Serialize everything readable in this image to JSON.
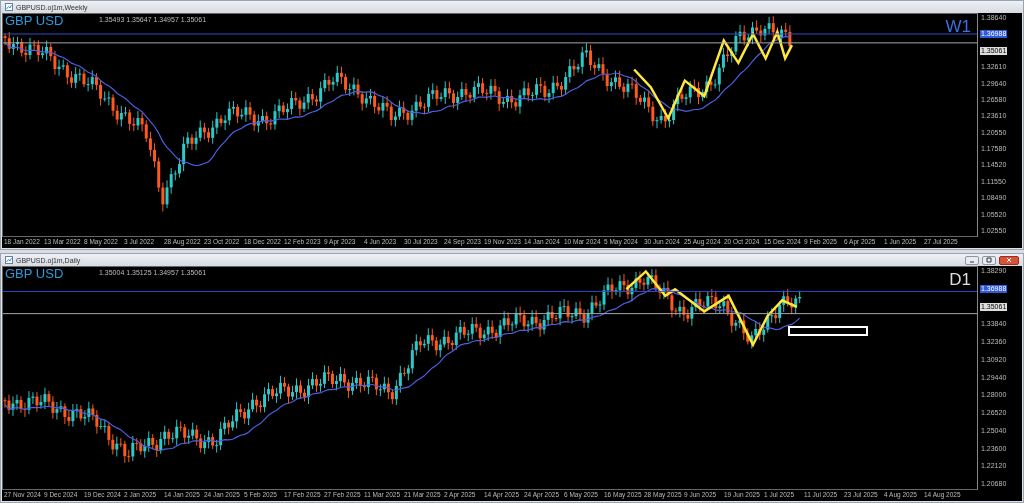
{
  "charts": [
    {
      "title": "GBPUSD.oj1m,Weekly",
      "symbol_label": "GBP USD",
      "quote": "1.35493 1.35647 1.34957 1.35061",
      "timeframe": "W1",
      "window_buttons": false,
      "marked_box": false,
      "price_axis": [
        {
          "kind": "tick",
          "text": "1.38640"
        },
        {
          "kind": "level",
          "text": "1.36988"
        },
        {
          "kind": "current",
          "text": "1.35061"
        },
        {
          "kind": "tick",
          "text": "1.32610"
        },
        {
          "kind": "tick",
          "text": "1.29640"
        },
        {
          "kind": "tick",
          "text": "1.26580"
        },
        {
          "kind": "tick",
          "text": "1.23610"
        },
        {
          "kind": "tick",
          "text": "1.20550"
        },
        {
          "kind": "tick",
          "text": "1.17580"
        },
        {
          "kind": "tick",
          "text": "1.14520"
        },
        {
          "kind": "tick",
          "text": "1.11550"
        },
        {
          "kind": "tick",
          "text": "1.08490"
        },
        {
          "kind": "tick",
          "text": "1.05520"
        },
        {
          "kind": "tick",
          "text": "1.02550"
        }
      ],
      "dates": [
        "18 Jan 2022",
        "13 Mar 2022",
        "8 May 2022",
        "3 Jul 2022",
        "28 Aug 2022",
        "23 Oct 2022",
        "18 Dec 2022",
        "12 Feb 2023",
        "9 Apr 2023",
        "4 Jun 2023",
        "30 Jul 2023",
        "24 Sep 2023",
        "19 Nov 2023",
        "14 Jan 2024",
        "10 Mar 2024",
        "5 May 2024",
        "30 Jun 2024",
        "25 Aug 2024",
        "20 Oct 2024",
        "15 Dec 2024",
        "9 Feb 2025",
        "6 Apr 2025",
        "1 Jun 2025",
        "27 Jul 2025"
      ]
    },
    {
      "title": "GBPUSD.oj1m,Daily",
      "symbol_label": "GBP USD",
      "quote": "1.35004 1.35125 1.34957 1.35061",
      "timeframe": "D1",
      "window_buttons": true,
      "marked_box": true,
      "price_axis": [
        {
          "kind": "tick",
          "text": "1.38290"
        },
        {
          "kind": "level",
          "text": "1.36988"
        },
        {
          "kind": "current",
          "text": "1.35061"
        },
        {
          "kind": "tick",
          "text": "1.33840"
        },
        {
          "kind": "tick",
          "text": "1.32360"
        },
        {
          "kind": "tick",
          "text": "1.30920"
        },
        {
          "kind": "tick",
          "text": "1.29440"
        },
        {
          "kind": "tick",
          "text": "1.28000"
        },
        {
          "kind": "tick",
          "text": "1.26520"
        },
        {
          "kind": "tick",
          "text": "1.25040"
        },
        {
          "kind": "tick",
          "text": "1.23600"
        },
        {
          "kind": "tick",
          "text": "1.22120"
        },
        {
          "kind": "tick",
          "text": "1.20680"
        }
      ],
      "dates": [
        "27 Nov 2024",
        "9 Dec 2024",
        "19 Dec 2024",
        "2 Jan 2025",
        "14 Jan 2025",
        "24 Jan 2025",
        "5 Feb 2025",
        "17 Feb 2025",
        "27 Feb 2025",
        "11 Mar 2025",
        "21 Mar 2025",
        "2 Apr 2025",
        "14 Apr 2025",
        "24 Apr 2025",
        "6 May 2025",
        "16 May 2025",
        "28 May 2025",
        "9 Jun 2025",
        "19 Jun 2025",
        "1 Jul 2025",
        "11 Jul 2025",
        "23 Jul 2025",
        "4 Aug 2025",
        "14 Aug 2025"
      ]
    }
  ]
}
